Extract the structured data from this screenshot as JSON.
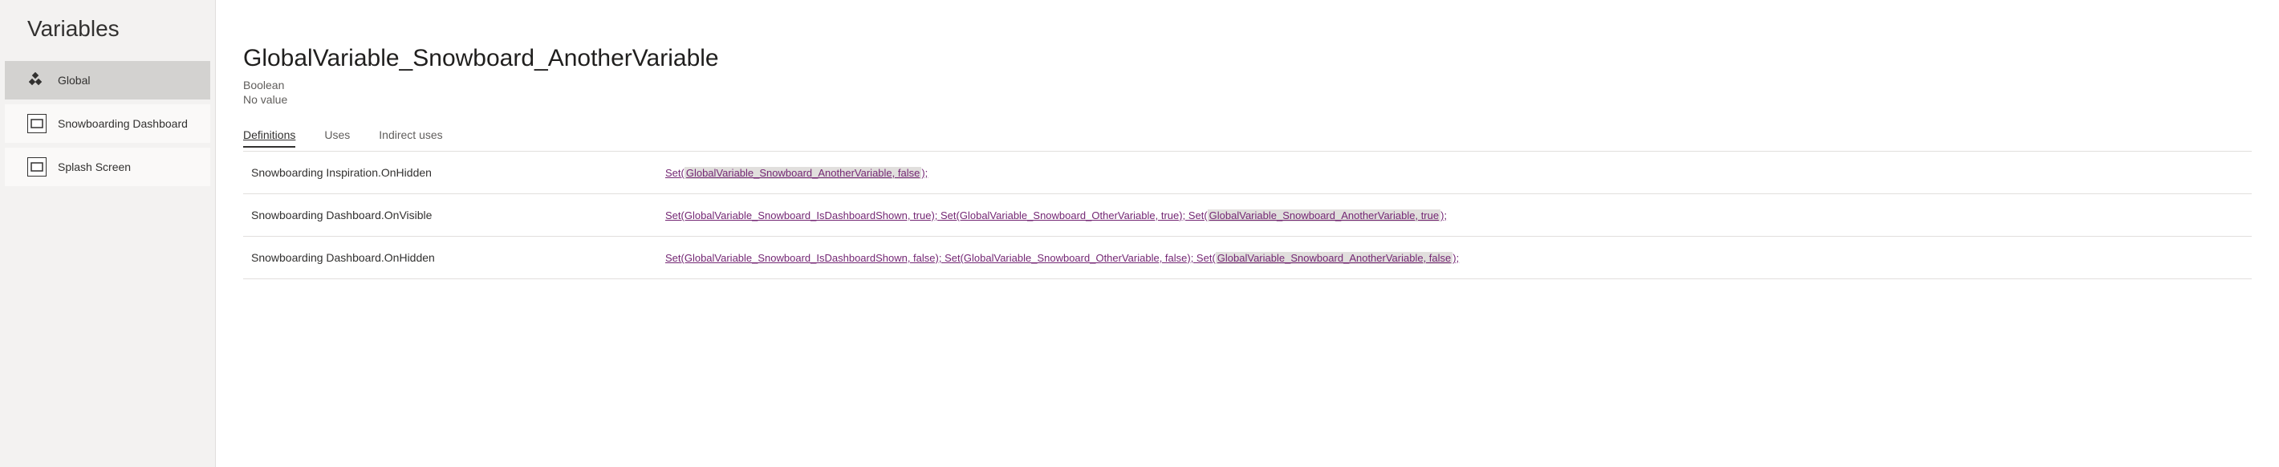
{
  "sidebar": {
    "title": "Variables",
    "items": [
      {
        "label": "Global",
        "selected": true,
        "icon": "diamond"
      },
      {
        "label": "Snowboarding Dashboard",
        "selected": false,
        "icon": "screen"
      },
      {
        "label": "Splash Screen",
        "selected": false,
        "icon": "screen"
      }
    ]
  },
  "variable": {
    "name": "GlobalVariable_Snowboard_AnotherVariable",
    "type": "Boolean",
    "value": "No value"
  },
  "tabs": [
    {
      "label": "Definitions",
      "active": true
    },
    {
      "label": "Uses",
      "active": false
    },
    {
      "label": "Indirect uses",
      "active": false
    }
  ],
  "definitions": [
    {
      "location": "Snowboarding Inspiration.OnHidden",
      "formula_parts": [
        {
          "text": "Set(",
          "hl": false
        },
        {
          "text": "GlobalVariable_Snowboard_AnotherVariable, false",
          "hl": true
        },
        {
          "text": ");",
          "hl": false
        }
      ]
    },
    {
      "location": "Snowboarding Dashboard.OnVisible",
      "formula_parts": [
        {
          "text": "Set(GlobalVariable_Snowboard_IsDashboardShown, true);  Set(GlobalVariable_Snowboard_OtherVariable, true);  Set(",
          "hl": false
        },
        {
          "text": "GlobalVariable_Snowboard_AnotherVariable, true",
          "hl": true
        },
        {
          "text": ");",
          "hl": false
        }
      ]
    },
    {
      "location": "Snowboarding Dashboard.OnHidden",
      "formula_parts": [
        {
          "text": "Set(GlobalVariable_Snowboard_IsDashboardShown, false);  Set(GlobalVariable_Snowboard_OtherVariable, false);  Set(",
          "hl": false
        },
        {
          "text": "GlobalVariable_Snowboard_AnotherVariable, false",
          "hl": true
        },
        {
          "text": ");",
          "hl": false
        }
      ]
    }
  ]
}
